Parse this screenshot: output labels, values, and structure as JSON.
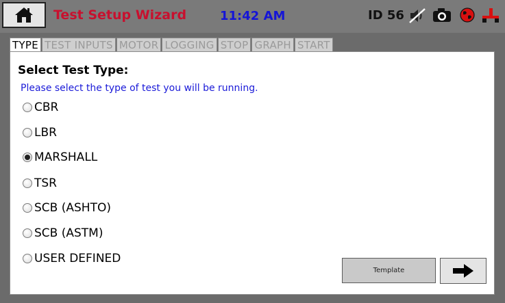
{
  "header": {
    "title": "Test Setup Wizard",
    "time": "11:42 AM",
    "id_label": "ID 56",
    "icons": [
      "home-icon",
      "mute-icon",
      "camera-icon",
      "globe-icon",
      "network-icon"
    ],
    "colors": {
      "title": "#c8102e",
      "time": "#1515d6"
    }
  },
  "tabs": [
    {
      "label": "TYPE",
      "active": true
    },
    {
      "label": "TEST INPUTS",
      "active": false
    },
    {
      "label": "MOTOR",
      "active": false
    },
    {
      "label": "LOGGING",
      "active": false
    },
    {
      "label": "STOP",
      "active": false
    },
    {
      "label": "GRAPH",
      "active": false
    },
    {
      "label": "START",
      "active": false
    }
  ],
  "main": {
    "heading": "Select Test Type:",
    "instruction": "Please select the type of test you will be running.",
    "options": [
      {
        "label": "CBR",
        "selected": false
      },
      {
        "label": "LBR",
        "selected": false
      },
      {
        "label": "MARSHALL",
        "selected": true
      },
      {
        "label": "TSR",
        "selected": false
      },
      {
        "label": "SCB (ASHTO)",
        "selected": false
      },
      {
        "label": "SCB (ASTM)",
        "selected": false
      },
      {
        "label": "USER DEFINED",
        "selected": false
      }
    ],
    "template_button": "Template",
    "next_icon": "arrow-right-icon"
  }
}
